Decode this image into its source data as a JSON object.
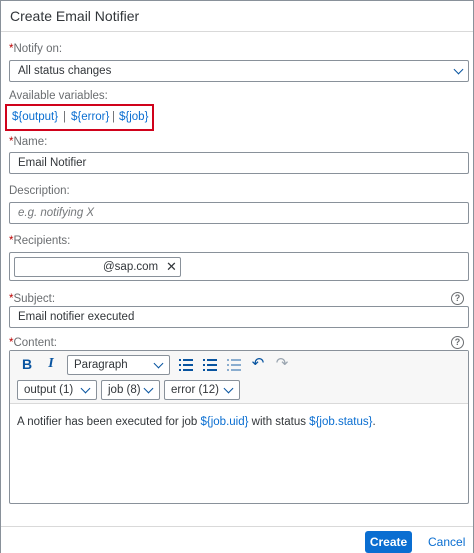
{
  "dialog": {
    "title": "Create Email Notifier"
  },
  "notify_on": {
    "required_mark": "*",
    "label": "Notify on:",
    "value": "All status changes"
  },
  "variables": {
    "label": "Available variables:",
    "items": [
      "${output}",
      "${error}",
      "${job}"
    ],
    "separator": "|"
  },
  "name": {
    "required_mark": "*",
    "label": "Name:",
    "value": "Email Notifier"
  },
  "description": {
    "label": "Description:",
    "placeholder": "e.g. notifying X"
  },
  "recipients": {
    "required_mark": "*",
    "label": "Recipients:",
    "token_text": "@sap.com",
    "token_remove": "✕"
  },
  "subject": {
    "required_mark": "*",
    "label": "Subject:",
    "value": "Email notifier executed",
    "help": "?"
  },
  "content": {
    "required_mark": "*",
    "label": "Content:",
    "help": "?",
    "toolbar": {
      "bold": "B",
      "italic": "I",
      "paragraph": "Paragraph",
      "insert_output": "output (1)",
      "insert_job": "job (8)",
      "insert_error": "error (12)"
    },
    "text_prefix": "A notifier has been executed for job ",
    "var_uid": "${job.uid}",
    "text_middle": " with status ",
    "var_status": "${job.status}",
    "text_suffix": "."
  },
  "footer": {
    "create": "Create",
    "cancel": "Cancel"
  },
  "colors": {
    "accent": "#0a6ed1",
    "highlight_box": "#d0021b",
    "required": "#bb0000"
  }
}
